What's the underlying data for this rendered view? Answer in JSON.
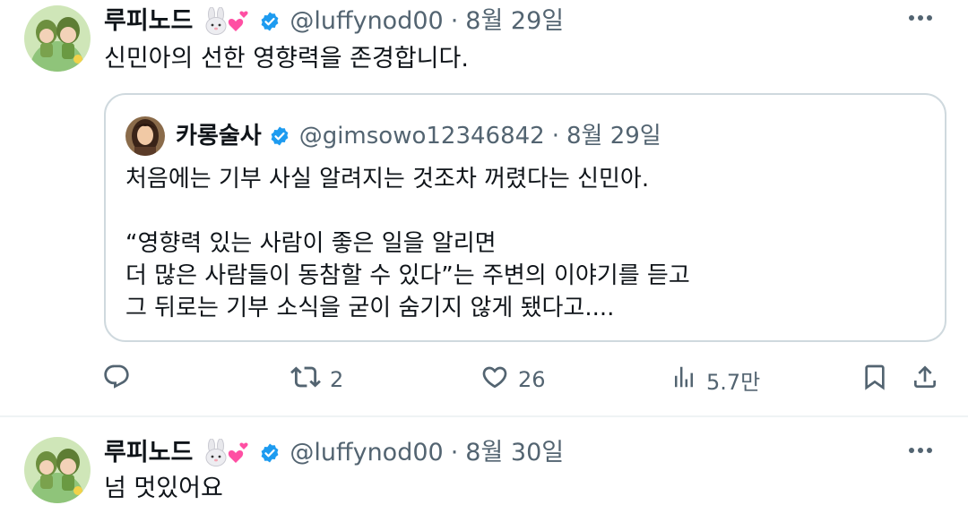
{
  "tweets": [
    {
      "display_name": "루피노드",
      "emoji": "🐰💕",
      "handle": "@luffynod00",
      "date": "8월 29일",
      "text": "신민아의 선한 영향력을 존경합니다.",
      "quote": {
        "display_name": "카롱술사",
        "handle": "@gimsowo12346842",
        "date": "8월 29일",
        "lines": [
          "처음에는 기부 사실 알려지는 것조차 꺼렸다는 신민아.",
          "“영향력 있는 사람이 좋은 일을 알리면",
          "더 많은 사람들이 동참할 수 있다”는 주변의 이야기를 듣고",
          "그 뒤로는 기부 소식을 굳이 숨기지 않게 됐다고...."
        ]
      },
      "actions": {
        "reply_count": "",
        "retweet_count": "2",
        "like_count": "26",
        "views_count": "5.7만"
      }
    },
    {
      "display_name": "루피노드",
      "emoji": "🐰💕",
      "handle": "@luffynod00",
      "date": "8월 30일",
      "text": "넘 멋있어요"
    }
  ],
  "separator": "·",
  "icons": {
    "verified": "verified-badge-icon",
    "more": "more-icon",
    "reply": "reply-icon",
    "retweet": "retweet-icon",
    "like": "like-icon",
    "views": "views-icon",
    "bookmark": "bookmark-icon",
    "share": "share-icon"
  },
  "colors": {
    "text_primary": "#0f1419",
    "text_secondary": "#536471",
    "verified_blue": "#1d9bf0",
    "border": "#cfd9de"
  }
}
